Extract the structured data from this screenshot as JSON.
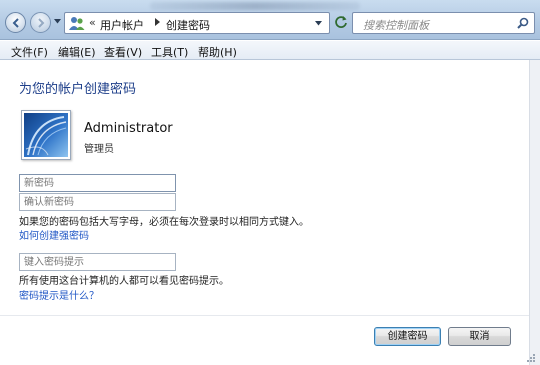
{
  "window": {
    "address": {
      "breadcrumbs": [
        "用户帐户",
        "创建密码"
      ]
    },
    "search": {
      "placeholder": "搜索控制面板"
    }
  },
  "menu": {
    "items": [
      "文件(F)",
      "编辑(E)",
      "查看(V)",
      "工具(T)",
      "帮助(H)"
    ]
  },
  "page": {
    "title": "为您的帐户创建密码",
    "user": {
      "name": "Administrator",
      "role": "管理员"
    },
    "fields": {
      "new_password_placeholder": "新密码",
      "confirm_password_placeholder": "确认新密码",
      "hint_placeholder": "键入密码提示"
    },
    "caps_note": "如果您的密码包括大写字母，必须在每次登录时以相同方式键入。",
    "strong_password_link": "如何创建强密码",
    "hint_visibility_note": "所有使用这台计算机的人都可以看见密码提示。",
    "hint_help_link": "密码提示是什么？"
  },
  "buttons": {
    "create": "创建密码",
    "cancel": "取消"
  },
  "colors": {
    "title": "#1e3f8a",
    "link": "#1f56c5",
    "glass": "#b4cbe4"
  }
}
